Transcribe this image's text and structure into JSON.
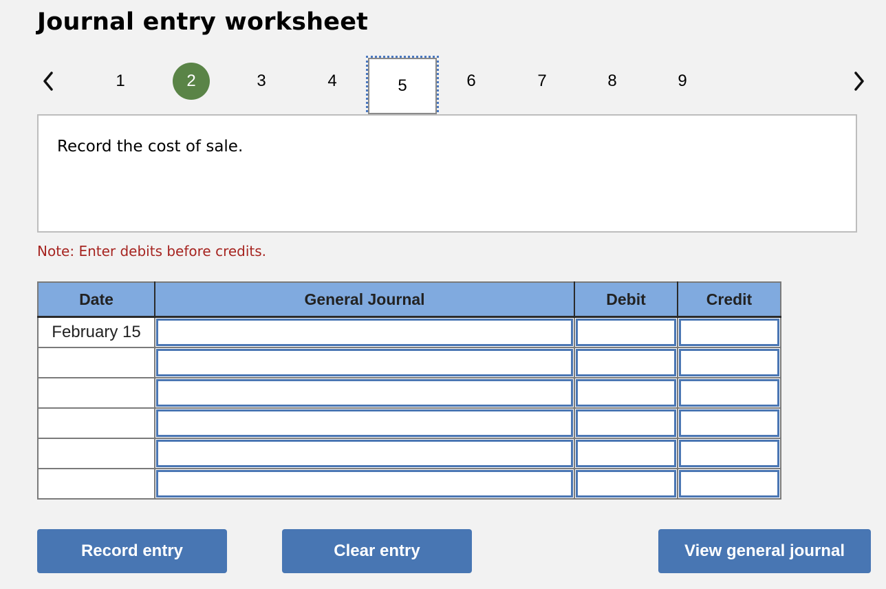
{
  "header": {
    "title": "Journal entry worksheet"
  },
  "pager": {
    "prev_icon": "chevron-left-icon",
    "next_icon": "chevron-right-icon",
    "pages": [
      "1",
      "2",
      "3",
      "4",
      "5",
      "6",
      "7",
      "8",
      "9"
    ],
    "completed_page": "2",
    "current_page": "5"
  },
  "prompt": {
    "text": "Record the cost of sale."
  },
  "note": "Note: Enter debits before credits.",
  "table": {
    "headers": {
      "date": "Date",
      "general_journal": "General Journal",
      "debit": "Debit",
      "credit": "Credit"
    },
    "rows": [
      {
        "date": "February 15",
        "account": "",
        "debit": "",
        "credit": ""
      },
      {
        "date": "",
        "account": "",
        "debit": "",
        "credit": ""
      },
      {
        "date": "",
        "account": "",
        "debit": "",
        "credit": ""
      },
      {
        "date": "",
        "account": "",
        "debit": "",
        "credit": ""
      },
      {
        "date": "",
        "account": "",
        "debit": "",
        "credit": ""
      },
      {
        "date": "",
        "account": "",
        "debit": "",
        "credit": ""
      }
    ]
  },
  "buttons": {
    "record": "Record entry",
    "clear": "Clear entry",
    "view": "View general journal"
  },
  "colors": {
    "completed": "#5a8447",
    "header_bg": "#80aadf",
    "button_bg": "#4876b3",
    "note_text": "#a62420"
  }
}
